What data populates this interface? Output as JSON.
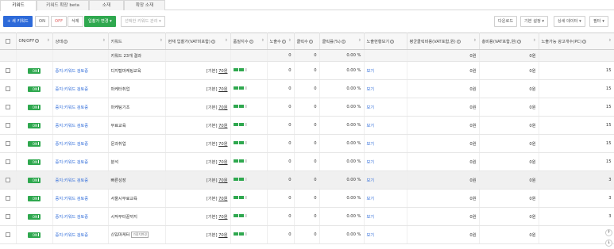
{
  "tabs": [
    "키워드",
    "키워드 확장 beta",
    "소재",
    "확장 소재"
  ],
  "toolbar": {
    "new_keyword": "+ 새 키워드",
    "on": "ON",
    "off": "OFF",
    "delete": "삭제",
    "bid_change": "입찰가 변경 ▾",
    "manage": "선택한 키워드 관리 ▾",
    "download": "다운로드",
    "basic_settings": "기본 설정 ▾",
    "detail_data": "상세 데이터 ▾",
    "filter": "필터 ▾"
  },
  "columns": {
    "onoff": "ON/OFF",
    "status": "상태",
    "keyword": "키워드",
    "bid": "현재 입찰가(VAT미포함)",
    "quality": "품질지수",
    "impressions": "노출수",
    "clicks": "클릭수",
    "ctr": "클릭률(%)",
    "view_impr": "노출현황보기",
    "cpc": "평균클릭비용(VAT포함,원)",
    "cost": "총비용(VAT포함,원)",
    "ad_count": "노출가능 광고개수(PC)"
  },
  "summary": {
    "label": "키워드 23개 결과",
    "impressions": "0",
    "clicks": "0",
    "ctr": "0.00 %",
    "cpc": "0원",
    "cost": "0원"
  },
  "rows": [
    {
      "toggle": "ON",
      "status": "중지:키워드 검토중",
      "keyword": "디지털마케팅교육",
      "bid_label": "[기본]",
      "bid": "70원",
      "quality_level": 4,
      "impressions": "0",
      "clicks": "0",
      "ctr": "0.00 %",
      "view": "보기",
      "cpc": "0원",
      "cost": "0원",
      "ad_count": "15",
      "tag": ""
    },
    {
      "toggle": "ON",
      "status": "중지:키워드 검토중",
      "keyword": "마케터취업",
      "bid_label": "[기본]",
      "bid": "70원",
      "quality_level": 4,
      "impressions": "0",
      "clicks": "0",
      "ctr": "0.00 %",
      "view": "보기",
      "cpc": "0원",
      "cost": "0원",
      "ad_count": "15",
      "tag": ""
    },
    {
      "toggle": "ON",
      "status": "중지:키워드 검토중",
      "keyword": "마케팅기초",
      "bid_label": "[기본]",
      "bid": "70원",
      "quality_level": 4,
      "impressions": "0",
      "clicks": "0",
      "ctr": "0.00 %",
      "view": "보기",
      "cpc": "0원",
      "cost": "0원",
      "ad_count": "15",
      "tag": ""
    },
    {
      "toggle": "ON",
      "status": "중지:키워드 검토중",
      "keyword": "무료교육",
      "bid_label": "[기본]",
      "bid": "70원",
      "quality_level": 4,
      "impressions": "0",
      "clicks": "0",
      "ctr": "0.00 %",
      "view": "보기",
      "cpc": "0원",
      "cost": "0원",
      "ad_count": "15",
      "tag": ""
    },
    {
      "toggle": "ON",
      "status": "중지:키워드 검토중",
      "keyword": "문과취업",
      "bid_label": "[기본]",
      "bid": "70원",
      "quality_level": 4,
      "impressions": "0",
      "clicks": "0",
      "ctr": "0.00 %",
      "view": "보기",
      "cpc": "0원",
      "cost": "0원",
      "ad_count": "15",
      "tag": ""
    },
    {
      "toggle": "ON",
      "status": "중지:키워드 검토중",
      "keyword": "분석",
      "bid_label": "[기본]",
      "bid": "70원",
      "quality_level": 4,
      "impressions": "0",
      "clicks": "0",
      "ctr": "0.00 %",
      "view": "보기",
      "cpc": "0원",
      "cost": "0원",
      "ad_count": "15",
      "tag": ""
    },
    {
      "toggle": "ON",
      "status": "중지:키워드 검토중",
      "keyword": "빠른성장",
      "bid_label": "[기본]",
      "bid": "70원",
      "quality_level": 4,
      "impressions": "0",
      "clicks": "0",
      "ctr": "0.00 %",
      "view": "보기",
      "cpc": "0원",
      "cost": "0원",
      "ad_count": "3",
      "tag": ""
    },
    {
      "toggle": "ON",
      "status": "중지:키워드 검토중",
      "keyword": "서울시무료교육",
      "bid_label": "[기본]",
      "bid": "70원",
      "quality_level": 4,
      "impressions": "0",
      "clicks": "0",
      "ctr": "0.00 %",
      "view": "보기",
      "cpc": "0원",
      "cost": "0원",
      "ad_count": "3",
      "tag": ""
    },
    {
      "toggle": "ON",
      "status": "중지:키워드 검토중",
      "keyword": "시작부터끝까지",
      "bid_label": "[기본]",
      "bid": "70원",
      "quality_level": 4,
      "impressions": "0",
      "clicks": "0",
      "ctr": "0.00 %",
      "view": "보기",
      "cpc": "0원",
      "cost": "0원",
      "ad_count": "3",
      "tag": ""
    },
    {
      "toggle": "ON",
      "status": "중지:키워드 검토중",
      "keyword": "신입마케터",
      "bid_label": "[기본]",
      "bid": "70원",
      "quality_level": 4,
      "impressions": "0",
      "clicks": "0",
      "ctr": "0.00 %",
      "view": "보기",
      "cpc": "0원",
      "cost": "0원",
      "ad_count": "3",
      "tag": "가중치변경"
    }
  ],
  "highlighted_row": 6,
  "colors": {
    "accent_blue": "#2d6ad9",
    "accent_green": "#2fa84f"
  }
}
